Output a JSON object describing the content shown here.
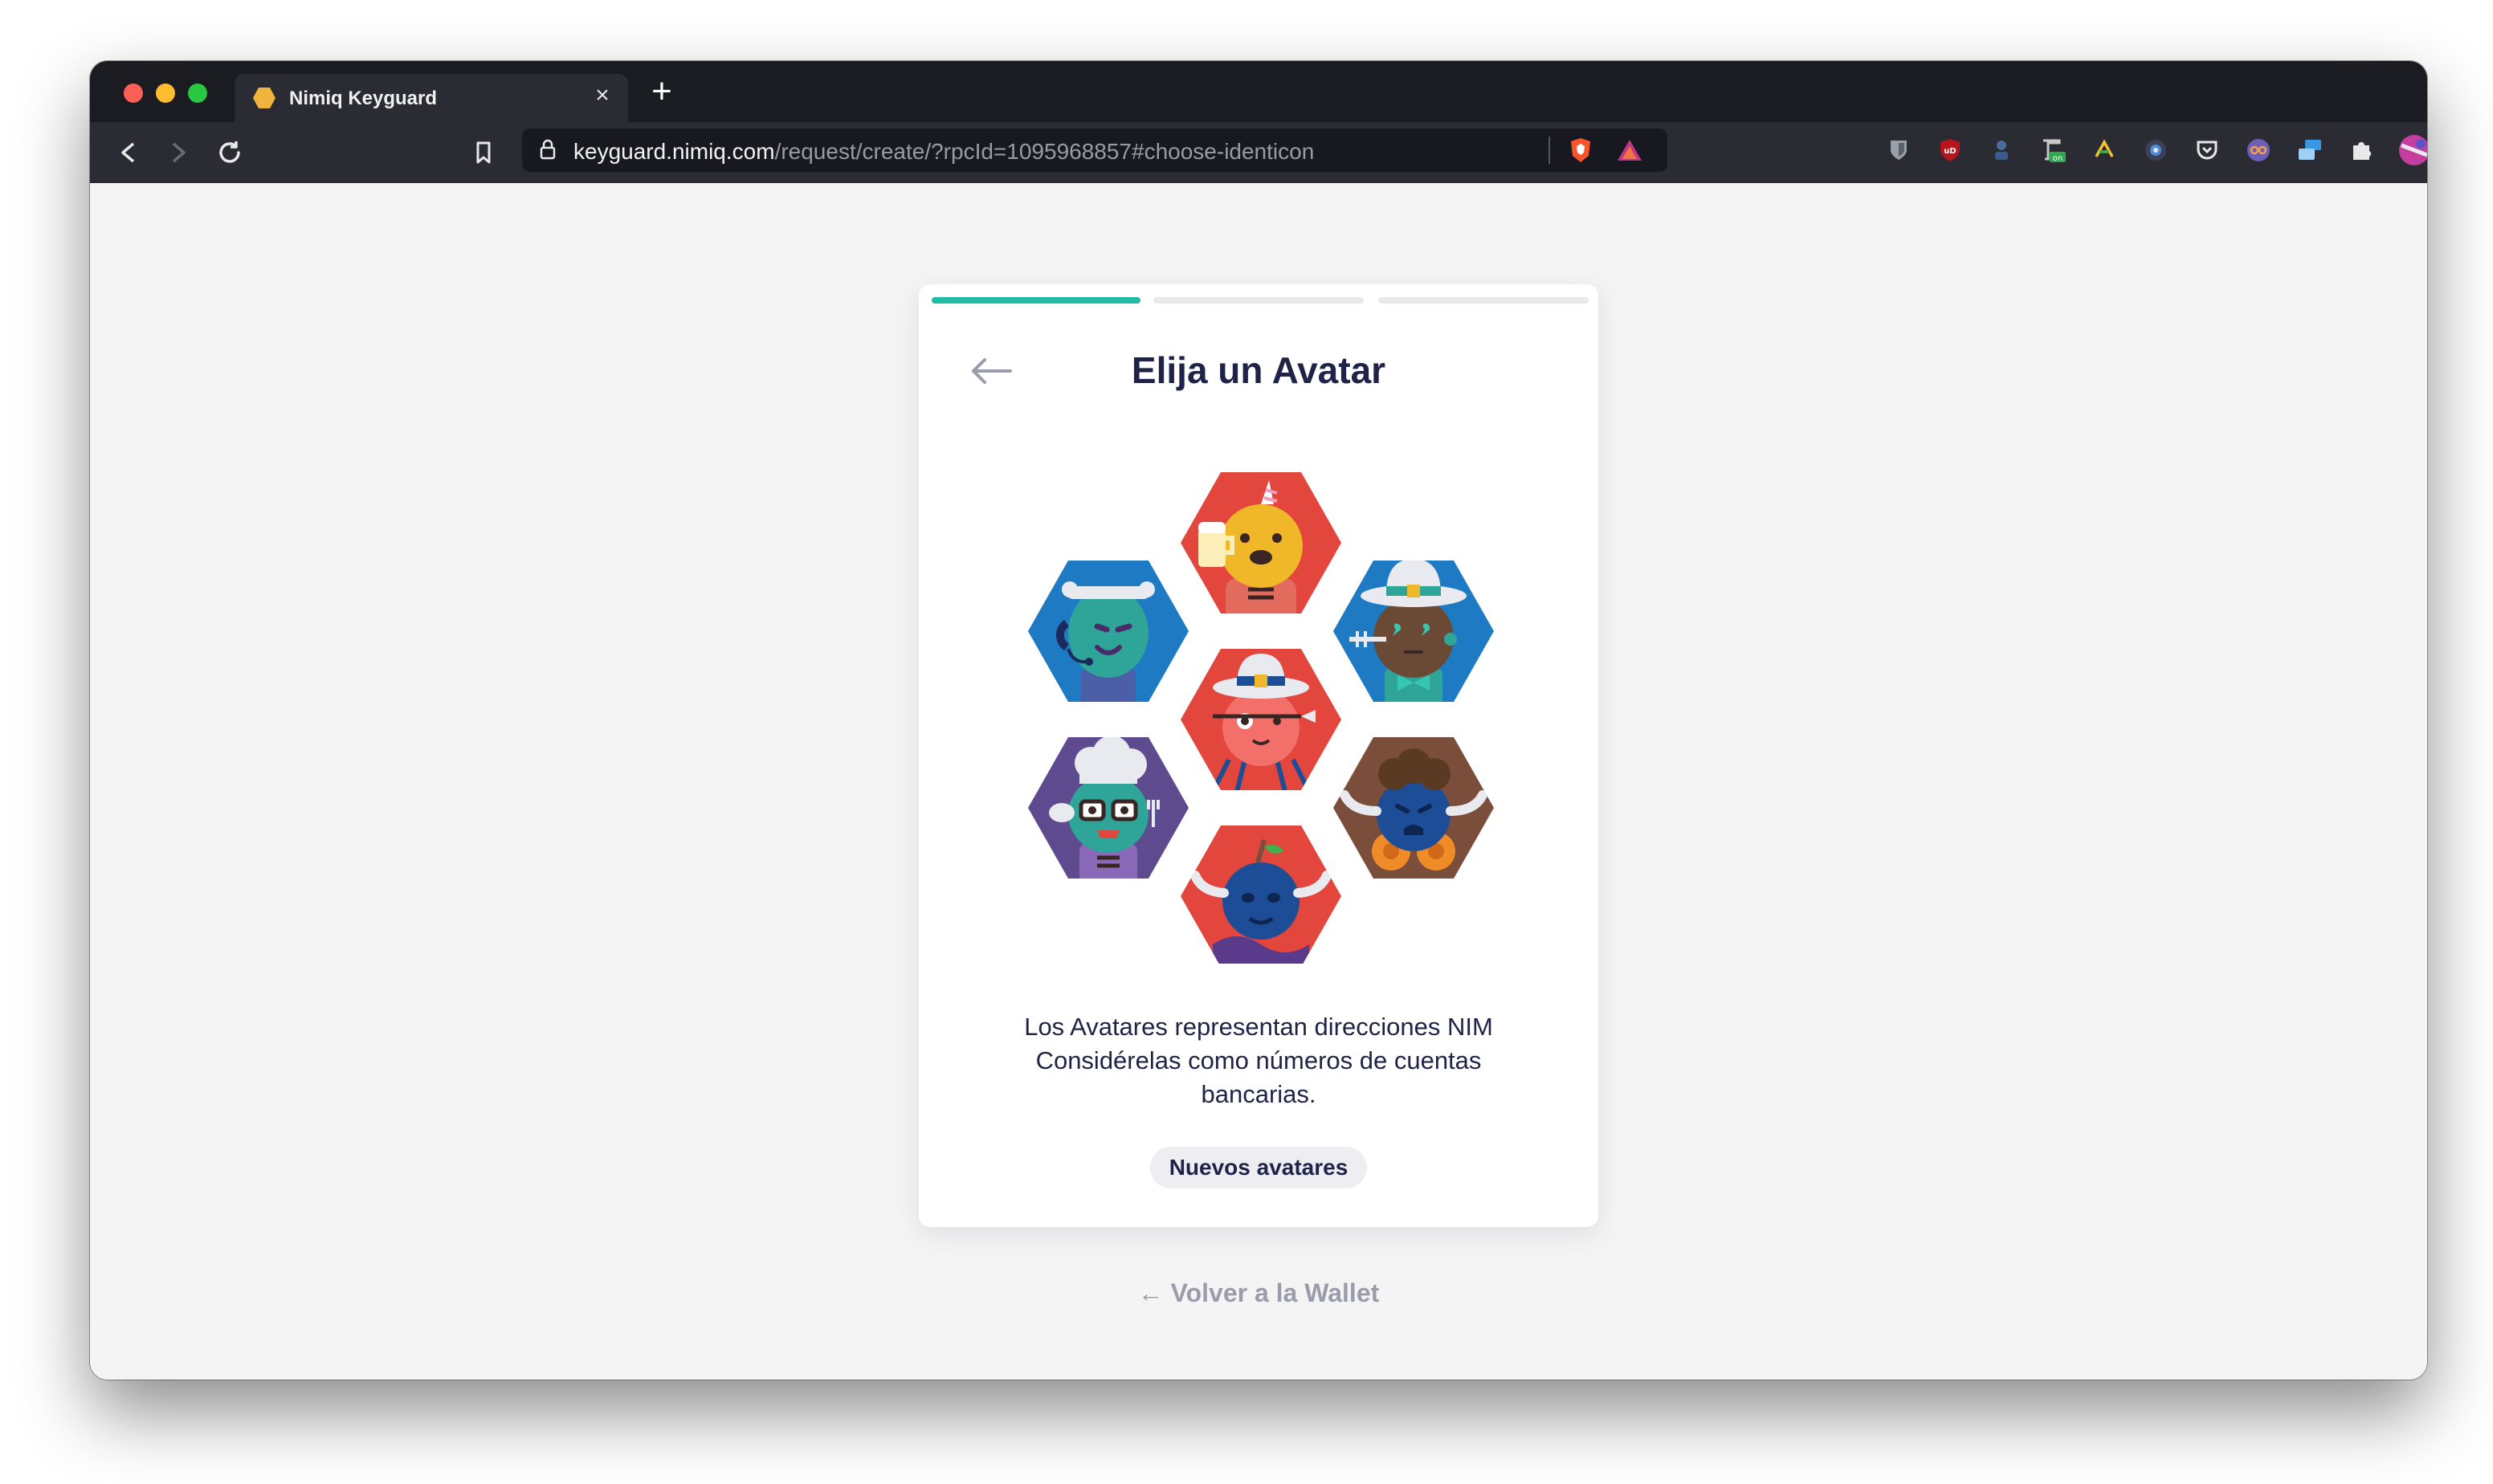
{
  "browser": {
    "tab_title": "Nimiq Keyguard",
    "tab_close": "×",
    "new_tab": "+",
    "url_host": "keyguard.nimiq.com",
    "url_path": "/request/create/?rpcId=1095968857#choose-identicon"
  },
  "card": {
    "title": "Elija un Avatar",
    "description_lines": [
      "Los Avatares representan direcciones NIM",
      "Considérelas como números de cuentas",
      "bancarias."
    ],
    "new_avatars_label": "Nuevos avatares",
    "progress": {
      "total_steps": 3,
      "current_step": 1
    }
  },
  "footer": {
    "back_link": "← Volver a la Wallet"
  },
  "avatars": [
    {
      "name": "bear-unicorn",
      "bg": "#e2463d",
      "face": "#f0b829"
    },
    {
      "name": "alien-headset",
      "bg": "#1f7ac4",
      "face": "#2ea598"
    },
    {
      "name": "hat-gentleman",
      "bg": "#1f7ac4",
      "face": "#6b4a35"
    },
    {
      "name": "pink-pilgrim",
      "bg": "#e2463d",
      "face": "#f26f6a"
    },
    {
      "name": "chef-nerd",
      "bg": "#5e4a8f",
      "face": "#2ea598"
    },
    {
      "name": "bull-curly",
      "bg": "#7a4e3a",
      "face": "#1d4d96"
    },
    {
      "name": "blue-bull",
      "bg": "#e2463d",
      "face": "#1d4d96"
    }
  ],
  "colors": {
    "accent": "#21bca5",
    "text_dark": "#1f2348",
    "text_muted": "#9b9cab"
  }
}
